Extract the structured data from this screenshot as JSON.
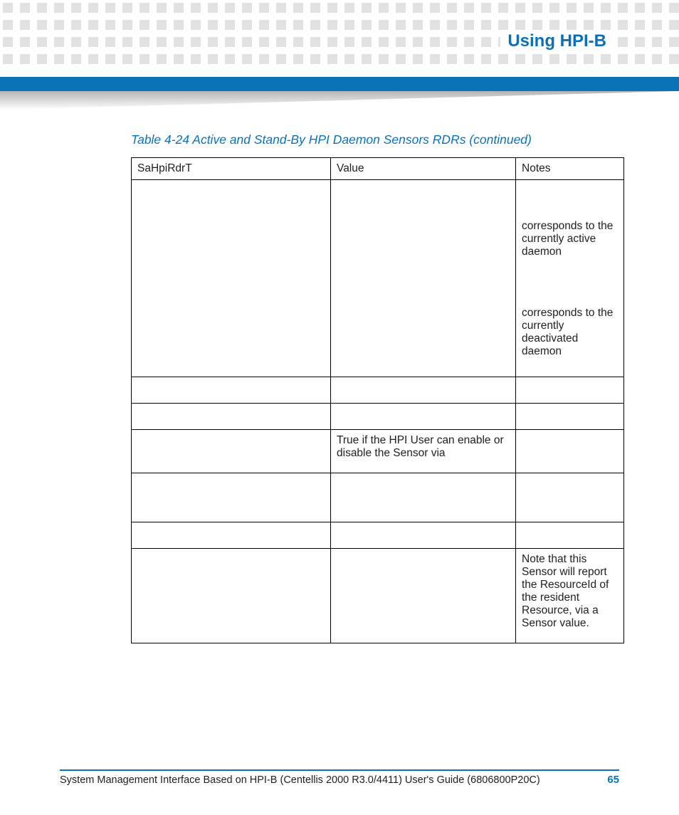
{
  "header": {
    "title": "Using HPI-B"
  },
  "caption": "Table 4-24 Active and Stand-By HPI Daemon Sensors RDRs (continued)",
  "cols": {
    "c1": "SaHpiRdrT",
    "c2": "Value",
    "c3": "Notes"
  },
  "rows": {
    "r1": {
      "c1": "",
      "c2": "",
      "note_a": "corresponds to the currently active daemon",
      "note_b": "corresponds to the currently deactivated daemon"
    },
    "r2": {
      "c1": "",
      "c2": "",
      "c3": ""
    },
    "r3": {
      "c1": "",
      "c2": "",
      "c3": ""
    },
    "r4": {
      "c1": "",
      "c2": "True if the HPI User can enable or disable the Sensor via",
      "c3": ""
    },
    "r5": {
      "c1": "",
      "c2": "",
      "c3": ""
    },
    "r6": {
      "c1": "",
      "c2": "",
      "c3": ""
    },
    "r7": {
      "c1": "",
      "c2": "",
      "c3": "Note that this Sensor will report the ResourceId of the resident Resource, via a Sensor value."
    }
  },
  "footer": {
    "text": "System Management Interface Based on HPI-B (Centellis 2000 R3.0/4411) User's Guide (6806800P20C)",
    "page": "65"
  }
}
